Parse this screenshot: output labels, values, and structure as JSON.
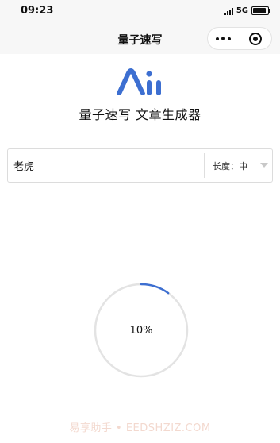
{
  "status_bar": {
    "time": "09:23",
    "network": "5G"
  },
  "nav": {
    "title": "量子速写",
    "more_icon": "more-dots-icon",
    "close_icon": "target-icon"
  },
  "app": {
    "title": "量子速写 文章生成器",
    "logo": "ai-logo-icon"
  },
  "form": {
    "topic_value": "老虎",
    "length_label": "长度：",
    "length_value": "中"
  },
  "progress": {
    "text": "10%",
    "value": 0.1,
    "accent": "#3d6fd1",
    "track": "#e3e3e3"
  },
  "watermark": "易享助手 • EEDSHZIZ.COM",
  "colors": {
    "nav_bg": "#f7f7f7",
    "logo_blue": "#3d6fd1"
  }
}
